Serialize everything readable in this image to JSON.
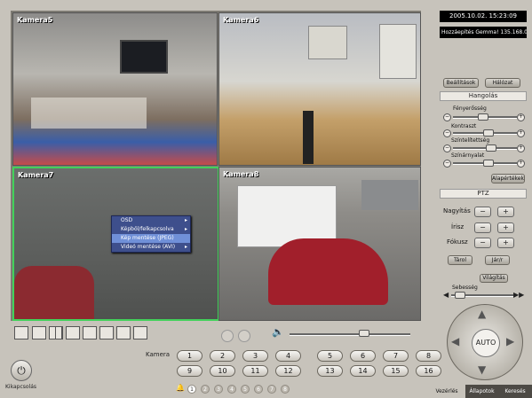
{
  "header": {
    "datetime": "2005.10.02. 15:23:09",
    "status": "Hozzáepítés Gemma! 135.168.0"
  },
  "cameras": [
    {
      "label": "Kamera5"
    },
    {
      "label": "Kamera6"
    },
    {
      "label": "Kamera7"
    },
    {
      "label": "Kamera8"
    }
  ],
  "context_menu": {
    "items": [
      {
        "label": "OSD",
        "submenu": true
      },
      {
        "label": "Képböl/felkapcsolva",
        "submenu": true
      },
      {
        "label": "Kép mentése (JPEG)",
        "submenu": false,
        "selected": true
      },
      {
        "label": "Videó mentése (AVI)",
        "submenu": true
      }
    ]
  },
  "right_panel": {
    "top_buttons": [
      "Beállítások",
      "Hálózat"
    ],
    "hangolas_title": "Hangolás",
    "sliders": [
      {
        "label": "Fényerősség",
        "value": 0.45
      },
      {
        "label": "Kontraszt",
        "value": 0.55
      },
      {
        "label": "Színtelítettség",
        "value": 0.6
      },
      {
        "label": "Színárnyalat",
        "value": 0.55
      }
    ],
    "default_button": "Alapértékek",
    "ptz_title": "PTZ",
    "ptz_rows": [
      "Nagyítás",
      "Írisz",
      "Fókusz"
    ],
    "plus": "+",
    "minus": "−",
    "open_button": "Tárol",
    "go_button": "Jár/r",
    "light_button": "Világítás",
    "speed_label": "Sebesség",
    "auto_label": "AUTO"
  },
  "bottom": {
    "kamera_label": "Kamera",
    "camera_numbers": [
      "1",
      "2",
      "3",
      "4",
      "5",
      "6",
      "7",
      "8",
      "9",
      "10",
      "11",
      "12",
      "13",
      "14",
      "15",
      "16"
    ],
    "dots": [
      "1",
      "2",
      "3",
      "4",
      "5",
      "6",
      "7",
      "8"
    ],
    "power_label": "Kikapcsolás",
    "tabs": [
      "Vezérlés",
      "Állapotok",
      "Keresés"
    ]
  }
}
